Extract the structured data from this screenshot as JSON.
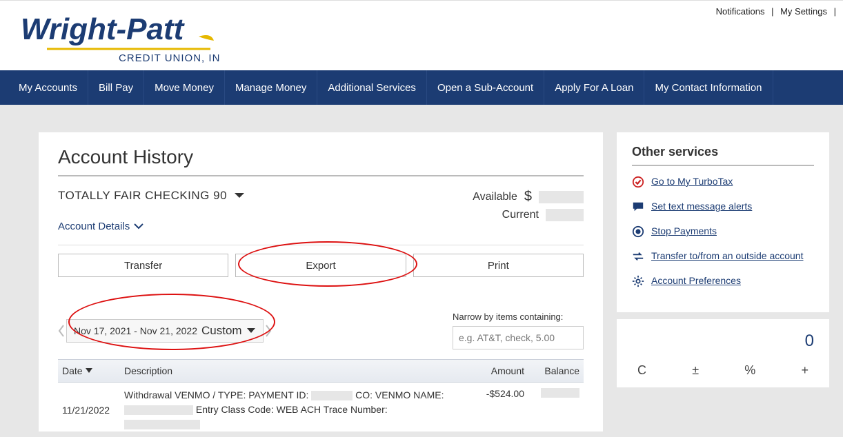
{
  "toplinks": {
    "notifications": "Notifications",
    "settings": "My Settings"
  },
  "nav": {
    "items": [
      "My Accounts",
      "Bill Pay",
      "Move Money",
      "Manage Money",
      "Additional Services",
      "Open a Sub-Account",
      "Apply For A Loan",
      "My Contact Information"
    ]
  },
  "page": {
    "title": "Account History",
    "account_name": "TOTALLY FAIR CHECKING  90",
    "details_link": "Account Details",
    "available_label": "Available",
    "current_label": "Current",
    "currency": "$"
  },
  "actions": {
    "transfer": "Transfer",
    "export": "Export",
    "print": "Print"
  },
  "filter": {
    "date_range": "Nov 17, 2021 - Nov 21, 2022",
    "custom_label": "Custom",
    "narrow_label": "Narrow by items containing:",
    "narrow_placeholder": "e.g. AT&T, check, 5.00"
  },
  "table": {
    "headers": {
      "date": "Date",
      "desc": "Description",
      "amount": "Amount",
      "balance": "Balance"
    },
    "rows": [
      {
        "date": "11/21/2022",
        "desc_pre": "Withdrawal VENMO / TYPE: PAYMENT ID: ",
        "desc_mid": " CO: VENMO NAME: ",
        "desc_post": " Entry Class Code: WEB ACH Trace Number: ",
        "amount": "-$524.00"
      }
    ]
  },
  "sidebar": {
    "title": "Other services",
    "items": [
      {
        "label": "Go to My TurboTax",
        "icon": "check-circle"
      },
      {
        "label": "Set text message alerts",
        "icon": "comment"
      },
      {
        "label": "Stop Payments",
        "icon": "record"
      },
      {
        "label": "Transfer to/from an outside account",
        "icon": "exchange"
      },
      {
        "label": "Account Preferences",
        "icon": "cog"
      }
    ]
  },
  "calc": {
    "display": "0",
    "keys": [
      "C",
      "±",
      "%",
      "+"
    ]
  }
}
